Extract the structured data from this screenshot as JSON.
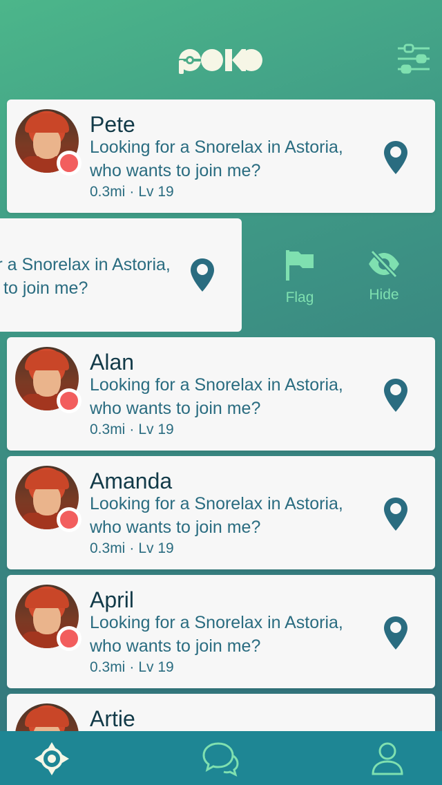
{
  "app": {
    "logo_text": "POKO"
  },
  "colors": {
    "accent": "#7fe0b0",
    "status": "#f25e5e",
    "tabbar": "#1e8694",
    "pin": "#2a6c80"
  },
  "header": {
    "filter_icon": "sliders-icon"
  },
  "feed": {
    "cards": [
      {
        "name": "Pete",
        "message": "Looking for a Snorelax in Astoria, who wants to join me?",
        "distance": "0.3mi",
        "separator": "·",
        "level": "Lv 19"
      },
      {
        "name": "Alan",
        "message": "Looking for a Snorelax in Astoria, who wants to join me?",
        "distance": "0.3mi",
        "separator": "·",
        "level": "Lv 19"
      },
      {
        "name": "Amanda",
        "message": "Looking for a Snorelax in Astoria, who wants to join me?",
        "distance": "0.3mi",
        "separator": "·",
        "level": "Lv 19"
      },
      {
        "name": "April",
        "message": "Looking for a Snorelax in Astoria, who wants to join me?",
        "distance": "0.3mi",
        "separator": "·",
        "level": "Lv 19"
      },
      {
        "name": "Artie",
        "message": "",
        "distance": "",
        "separator": "",
        "level": ""
      }
    ],
    "swiped": {
      "message": "Looking for a Snorelax in Astoria, who wants to join me?",
      "actions": {
        "flag": "Flag",
        "hide": "Hide"
      }
    }
  },
  "tabbar": {
    "tabs": [
      "crosshair-icon",
      "chat-icon",
      "profile-icon"
    ]
  }
}
